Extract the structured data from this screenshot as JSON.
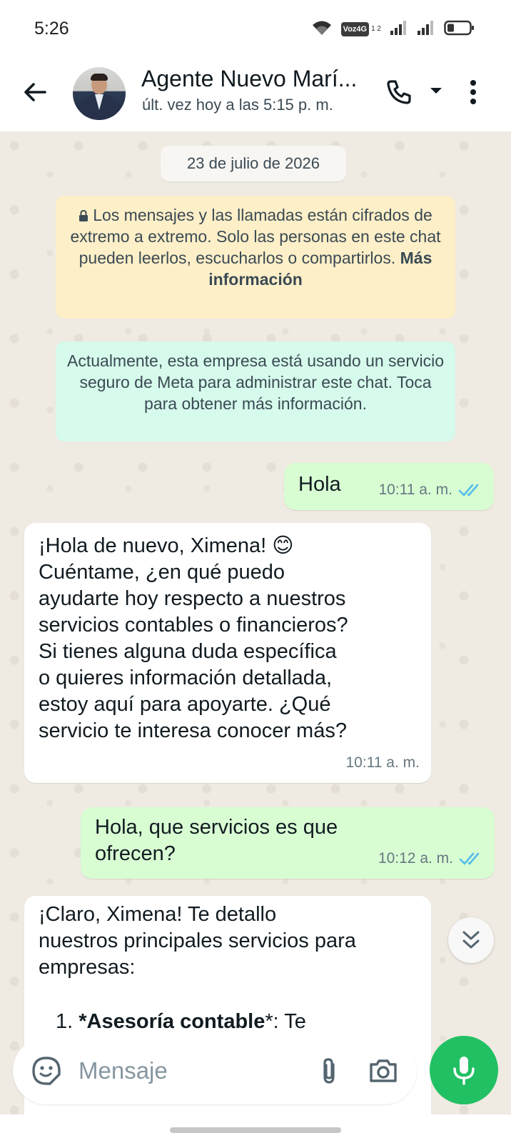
{
  "status_bar": {
    "time": "5:26",
    "network_badge": "Voz4G",
    "network_sub": "1 2",
    "icons": [
      "wifi-icon",
      "signal-icon",
      "signal-icon",
      "battery-icon"
    ]
  },
  "header": {
    "contact_name": "Agente Nuevo Marí...",
    "last_seen": "últ. vez hoy a las 5:15 p. m.",
    "icons": [
      "back-arrow-icon",
      "phone-icon",
      "caret-down-icon",
      "more-vert-icon"
    ]
  },
  "chat": {
    "date_chip": "23 de julio de 2026",
    "encryption_notice": {
      "text": "Los mensajes y las llamadas están cifrados de extremo a extremo. Solo las personas en este chat pueden leerlos, escucharlos o compartirlos.",
      "link": "Más información"
    },
    "meta_notice": "Actualmente, esta empresa está usando un servicio seguro de Meta para administrar este chat. Toca para obtener más información.",
    "messages": [
      {
        "direction": "out",
        "text": "Hola",
        "time": "10:11 a. m.",
        "status": "read"
      },
      {
        "direction": "in",
        "text_first": "¡Hola de nuevo, Ximena! ",
        "emoji": "😊",
        "text_rest": "Cuéntame, ¿en qué puedo\nayudarte hoy respecto a nuestros\nservicios contables o financieros?\nSi tienes alguna duda específica\no quieres información detallada,\nestoy aquí para apoyarte. ¿Qué\nservicio te interesa conocer más?",
        "time": "10:11 a. m."
      },
      {
        "direction": "out",
        "text": "Hola, que servicios es que\nofrecen?",
        "time": "10:12 a. m.",
        "status": "read"
      },
      {
        "direction": "in",
        "text": "¡Claro, Ximena! Te detallo\nnuestros principales servicios para\nempresas:",
        "list_number": "1.",
        "list_bold": "*Asesoría contable",
        "list_rest": "*: Te"
      }
    ]
  },
  "input": {
    "placeholder": "Mensaje",
    "icons": [
      "sticker-emoji-icon",
      "paperclip-icon",
      "camera-icon",
      "microphone-icon"
    ]
  },
  "colors": {
    "chat_bg": "#efeae2",
    "outgoing_bubble": "#d9fdd3",
    "incoming_bubble": "#ffffff",
    "encryption_notice_bg": "#fdefc8",
    "meta_notice_bg": "#d6faeb",
    "read_ticks": "#53bdeb",
    "accent_green": "#21c063"
  }
}
